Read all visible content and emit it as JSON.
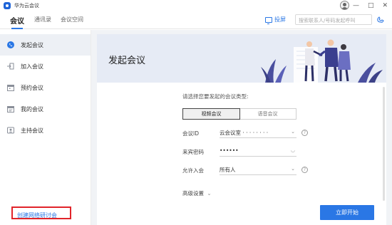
{
  "window": {
    "app_title": "华为云会议",
    "controls": {
      "minimize": "—",
      "maximize": "□",
      "close": "✕"
    }
  },
  "tabs": [
    {
      "label": "会议",
      "active": true
    },
    {
      "label": "通讯录",
      "active": false
    },
    {
      "label": "会议空间",
      "active": false
    }
  ],
  "toolbar": {
    "share_label": "投屏",
    "search_placeholder": "搜索联系人/号码发起呼叫"
  },
  "sidebar": {
    "items": [
      {
        "label": "发起会议",
        "icon": "phone-icon",
        "active": true
      },
      {
        "label": "加入会议",
        "icon": "join-icon",
        "active": false
      },
      {
        "label": "预约会议",
        "icon": "calendar-icon",
        "active": false
      },
      {
        "label": "我的会议",
        "icon": "calendar-list-icon",
        "active": false
      },
      {
        "label": "主持会议",
        "icon": "host-icon",
        "active": false
      }
    ],
    "create_webinar": "创建网络研讨会"
  },
  "main": {
    "banner_title": "发起会议",
    "form_title": "请选择您要发起的会议类型:",
    "meeting_types": [
      {
        "label": "视频会议",
        "selected": true
      },
      {
        "label": "语音会议",
        "selected": false
      }
    ],
    "fields": {
      "meeting_id_label": "会议ID",
      "meeting_id_value": "云会议室 · · · · · · · ·",
      "guest_pwd_label": "来宾密码",
      "guest_pwd_value": "••••••",
      "allow_join_label": "允许入会",
      "allow_join_value": "所有人"
    },
    "advanced_label": "高级设置",
    "start_button": "立即开始"
  },
  "colors": {
    "accent": "#2a77e5",
    "highlight_box": "#e1242a",
    "banner_bg": "#e6ebf5"
  }
}
